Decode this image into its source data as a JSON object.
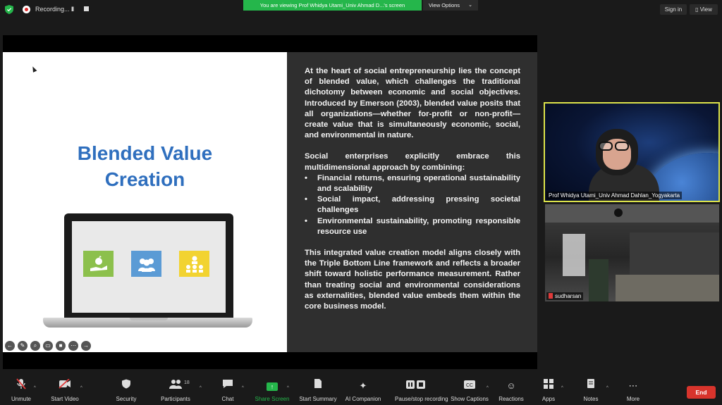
{
  "topbar": {
    "recording_label": "Recording...",
    "pause_label": "II",
    "viewing_banner": "You are viewing Prof Whidya Utami_Univ Ahmad D...'s screen",
    "view_options_label": "View Options",
    "sign_in_label": "Sign in",
    "view_label": "View"
  },
  "slide": {
    "title_line1": "Blended Value",
    "title_line2": "Creation",
    "para1": "At the heart of social entrepreneurship lies the concept of blended value, which challenges the traditional dichotomy between economic and social objectives. Introduced by Emerson (2003), blended value posits that all organizations—whether for-profit or non-profit—create value that is simultaneously economic, social, and environmental in nature.",
    "para2": "Social enterprises explicitly embrace this multidimensional approach by combining:",
    "bullets": [
      "Financial returns, ensuring operational sustainability and scalability",
      "Social impact, addressing pressing societal challenges",
      "Environmental sustainability, promoting responsible resource use"
    ],
    "para3": "This integrated value creation model aligns closely with the Triple Bottom Line framework and reflects a broader shift toward holistic performance measurement. Rather than treating social and environmental considerations as externalities, blended value embeds them within the core business model."
  },
  "participants_video": {
    "speaker_name": "Prof Whidya Utami_Univ Ahmad Dahlan_Yogyakarta",
    "second_name": "sudharsan"
  },
  "toolbar": {
    "unmute": "Unmute",
    "start_video": "Start Video",
    "security": "Security",
    "participants": "Participants",
    "participants_count": "18",
    "chat": "Chat",
    "share_screen": "Share Screen",
    "start_summary": "Start Summary",
    "ai_companion": "AI Companion",
    "pause_stop_recording": "Pause/stop recording",
    "show_captions": "Show Captions",
    "reactions": "Reactions",
    "apps": "Apps",
    "notes": "Notes",
    "more": "More",
    "end": "End"
  },
  "colors": {
    "banner_green": "#25b64b",
    "slide_title_blue": "#2f6fbe",
    "end_red": "#d8342c",
    "active_speaker_border": "#dce34a"
  }
}
